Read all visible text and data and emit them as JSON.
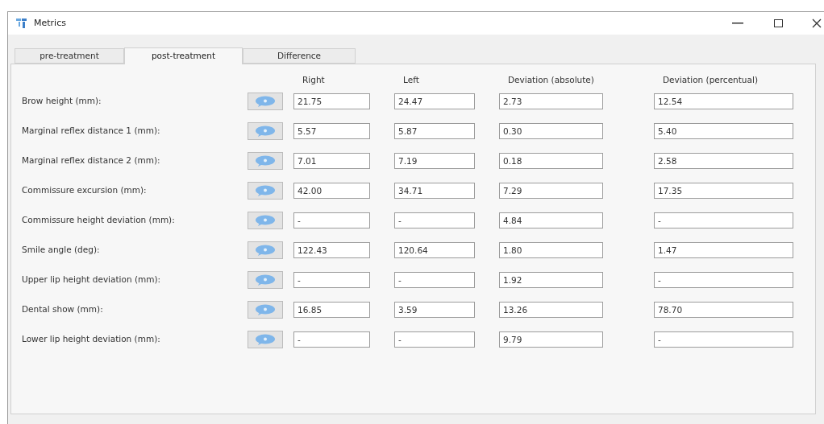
{
  "window": {
    "title": "Metrics"
  },
  "tabs": [
    {
      "label": "pre-treatment",
      "selected": false
    },
    {
      "label": "post-treatment",
      "selected": true
    },
    {
      "label": "Difference",
      "selected": false
    }
  ],
  "columns": [
    "Right",
    "Left",
    "Deviation (absolute)",
    "Deviation (percentual)"
  ],
  "rows": [
    {
      "label": "Brow height (mm):",
      "values": [
        "21.75",
        "24.47",
        "2.73",
        "12.54"
      ]
    },
    {
      "label": "Marginal reflex distance 1 (mm):",
      "values": [
        "5.57",
        "5.87",
        "0.30",
        "5.40"
      ]
    },
    {
      "label": "Marginal reflex distance 2 (mm):",
      "values": [
        "7.01",
        "7.19",
        "0.18",
        "2.58"
      ]
    },
    {
      "label": "Commissure excursion (mm):",
      "values": [
        "42.00",
        "34.71",
        "7.29",
        "17.35"
      ]
    },
    {
      "label": "Commissure height deviation (mm):",
      "values": [
        "-",
        "-",
        "4.84",
        "-"
      ]
    },
    {
      "label": "Smile angle (deg):",
      "values": [
        "122.43",
        "120.64",
        "1.80",
        "1.47"
      ]
    },
    {
      "label": "Upper lip height deviation (mm):",
      "values": [
        "-",
        "-",
        "1.92",
        "-"
      ]
    },
    {
      "label": "Dental show (mm):",
      "values": [
        "16.85",
        "3.59",
        "13.26",
        "78.70"
      ]
    },
    {
      "label": "Lower lip height deviation (mm):",
      "values": [
        "-",
        "-",
        "9.79",
        "-"
      ]
    }
  ]
}
